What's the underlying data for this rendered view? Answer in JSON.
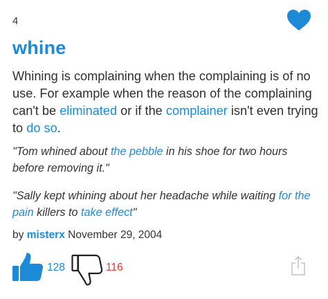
{
  "entry": {
    "rank": "4",
    "word": "whine",
    "definition": {
      "t1": "Whining is complaining when the complaining is of no use. For example when the reason of the complaining can't be ",
      "l1": "eliminated",
      "t2": " or if the ",
      "l2": "complainer",
      "t3": " isn't even trying to ",
      "l3": "do so",
      "t4": "."
    },
    "example1": {
      "t1": "\"Tom whined about ",
      "l1": "the pebble",
      "t2": " in his shoe for two hours before removing it.\""
    },
    "example2": {
      "t1": "\"Sally kept whining about her headache while waiting ",
      "l1": "for the pain",
      "t2": " killers to ",
      "l2": "take effect",
      "t3": "\""
    },
    "byline": {
      "prefix": "by ",
      "author": "misterx",
      "date": " November 29, 2004"
    },
    "votes": {
      "up": "128",
      "down": "116"
    }
  },
  "colors": {
    "accent": "#1d8ad8",
    "heart": "#1d8ad8",
    "downvote": "#e53935"
  },
  "icons": {
    "favorite": "heart-icon",
    "upvote": "thumbs-up-icon",
    "downvote": "thumbs-down-icon",
    "share": "share-icon"
  }
}
